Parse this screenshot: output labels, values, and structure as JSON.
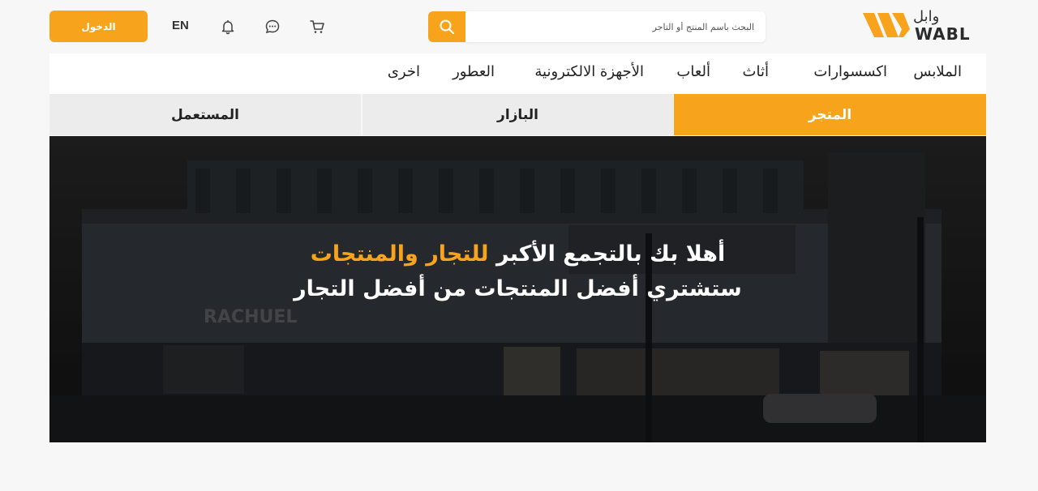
{
  "brand": {
    "logo_ar": "وابل",
    "logo_en": "WABL",
    "accent_color": "#f8a31c"
  },
  "header": {
    "search_placeholder": "البحث باسم المنتج أو التاجر",
    "search_icon": "search-icon",
    "cart_icon": "cart-icon",
    "chat_icon": "chat-icon",
    "bell_icon": "bell-icon",
    "lang_label": "EN",
    "login_label": "الدخول"
  },
  "categories": [
    "الملابس",
    "اكسسوارات",
    "أثاث",
    "ألعاب",
    "الأجهزة الالكترونية",
    "العطور",
    "اخرى"
  ],
  "tabs": [
    {
      "label": "المتجر",
      "active": true
    },
    {
      "label": "البازار",
      "active": false
    },
    {
      "label": "المستعمل",
      "active": false
    }
  ],
  "hero": {
    "line1_prefix": "أهلا بك بالتجمع الأكبر",
    "line1_highlight": "للتجار والمنتجات",
    "line2": "ستشتري أفضل المنتجات من أفضل التجار",
    "bg_sign": "RACHUEL"
  }
}
